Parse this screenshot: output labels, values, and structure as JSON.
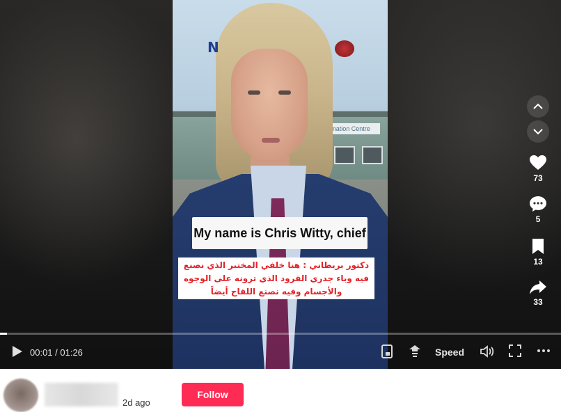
{
  "video": {
    "caption_english": "My name is Chris Witty, chief",
    "caption_arabic_line1": "دكتور بريطاني : هنا خلفي المختبر الذي نصنع",
    "caption_arabic_line2": "فيه وباء جدري القرود الذي ترونه على الوجوه",
    "caption_arabic_line3": "والأجسام وفيه نصنع اللقاح أيضاً",
    "building_sign": "rmation Centre",
    "logo_left": "N",
    "progress_fraction": 0.013
  },
  "actions": {
    "likes": "73",
    "comments": "5",
    "saves": "13",
    "shares": "33"
  },
  "controls": {
    "time_display": "00:01 / 01:26",
    "speed_label": "Speed"
  },
  "author": {
    "posted": "2d ago",
    "follow_label": "Follow"
  },
  "colors": {
    "follow_button": "#fe2c55",
    "arabic_caption": "#e3232a"
  }
}
